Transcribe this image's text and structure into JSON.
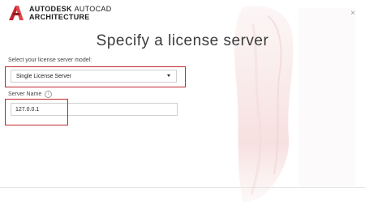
{
  "window": {
    "brand_line1_bold": "AUTODESK",
    "brand_line1_product": "AUTOCAD",
    "brand_line2": "ARCHITECTURE",
    "close_glyph": "×",
    "close_icon": "close-icon",
    "logo_icon": "autodesk-a-logo-icon",
    "brand_color": "#c0262d"
  },
  "page": {
    "title": "Specify a license server"
  },
  "license_model": {
    "label": "Select your license server model:",
    "selected": "Single License Server",
    "icon": "chevron-down-icon"
  },
  "server": {
    "label": "Server Name",
    "value": "127.0.0.1",
    "info_glyph": "i",
    "info_icon": "info-icon"
  },
  "highlight_color": "#c0262d"
}
